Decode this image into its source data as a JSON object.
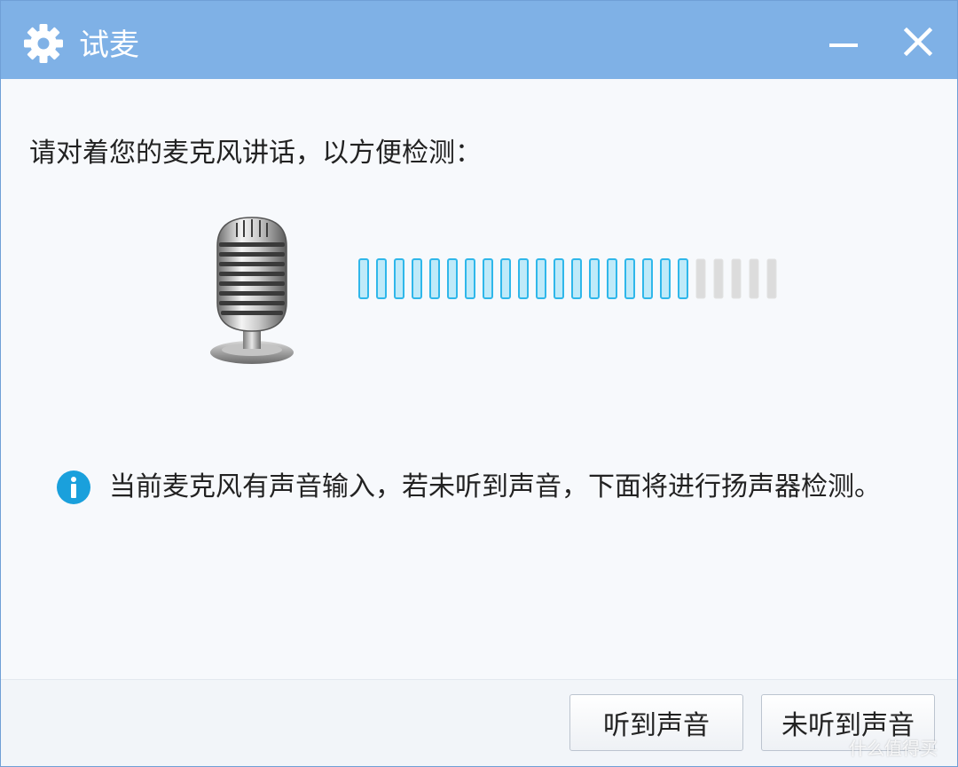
{
  "window": {
    "title": "试麦",
    "title_icon": "gear-icon",
    "controls": {
      "minimize_icon": "minimize-icon",
      "close_icon": "close-icon"
    }
  },
  "body": {
    "prompt": "请对着您的麦克风讲话，以方便检测：",
    "microphone_icon": "microphone-icon",
    "level_meter": {
      "total_segments": 24,
      "active_segments": 19,
      "active_color": "#2fb7ea",
      "inactive_color": "#dcdcdc"
    },
    "info": {
      "icon": "info-icon",
      "text": "当前麦克风有声音输入，若未听到声音，下面将进行扬声器检测。"
    }
  },
  "footer": {
    "heard_label": "听到声音",
    "not_heard_label": "未听到声音"
  },
  "watermark": "什么值得买",
  "colors": {
    "titlebar": "#7fb1e6",
    "accent": "#2fb7ea",
    "info": "#1aa0dc"
  }
}
